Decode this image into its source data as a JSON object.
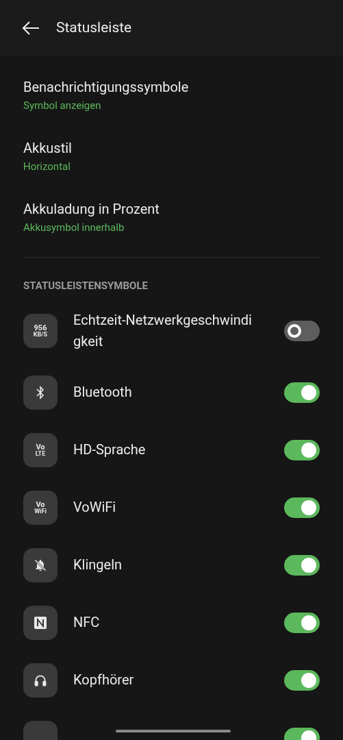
{
  "header": {
    "title": "Statusleiste"
  },
  "settings": [
    {
      "title": "Benachrichtigungssymbole",
      "value": "Symbol anzeigen"
    },
    {
      "title": "Akkustil",
      "value": "Horizontal"
    },
    {
      "title": "Akkuladung in Prozent",
      "value": "Akkusymbol innerhalb"
    }
  ],
  "section": {
    "heading": "STATUSLEISTENSYMBOLE"
  },
  "toggles": [
    {
      "kind": "text",
      "icon_text": [
        "956",
        "KB/S"
      ],
      "label": "Echtzeit-Netzwerkgeschwindigkeit",
      "on": false
    },
    {
      "kind": "bluetooth",
      "label": "Bluetooth",
      "on": true
    },
    {
      "kind": "text",
      "icon_text": [
        "Vo",
        "LTE"
      ],
      "label": "HD-Sprache",
      "on": true
    },
    {
      "kind": "text",
      "icon_text": [
        "Vo",
        "WiFi"
      ],
      "label": "VoWiFi",
      "on": true
    },
    {
      "kind": "bell-off",
      "label": "Klingeln",
      "on": true
    },
    {
      "kind": "nfc",
      "label": "NFC",
      "on": true
    },
    {
      "kind": "headphones",
      "label": "Kopfhörer",
      "on": true
    },
    {
      "kind": "blank",
      "on": true
    }
  ]
}
